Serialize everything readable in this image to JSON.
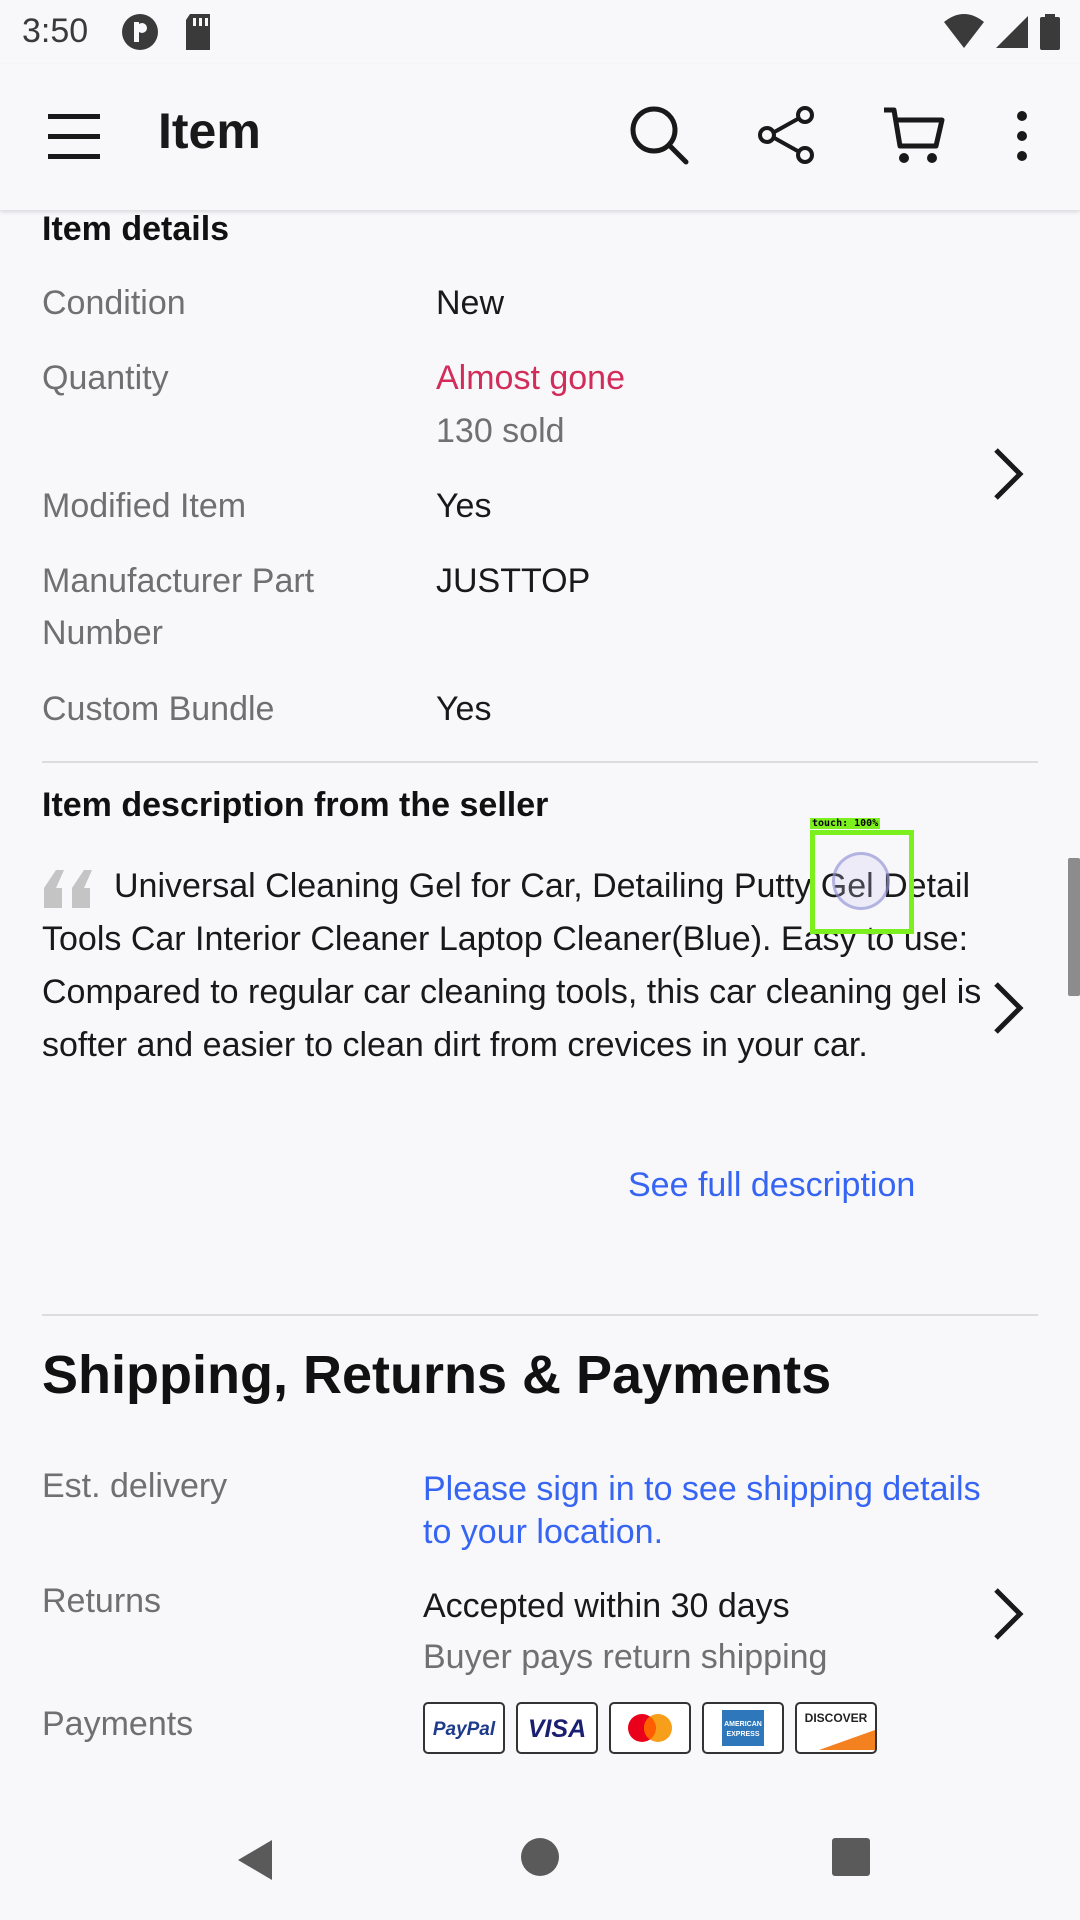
{
  "status_bar": {
    "time": "3:50",
    "icons": [
      "circle-p-icon",
      "sd-card-icon",
      "wifi-icon",
      "signal-icon",
      "battery-icon"
    ]
  },
  "app_bar": {
    "title": "Item",
    "icons": [
      "menu-icon",
      "search-icon",
      "share-icon",
      "cart-icon",
      "more-vert-icon"
    ]
  },
  "item_details": {
    "heading": "Item details",
    "condition_label": "Condition",
    "condition_value": "New",
    "quantity_label": "Quantity",
    "quantity_status": "Almost gone",
    "quantity_sold": "130 sold",
    "modified_label": "Modified Item",
    "modified_value": "Yes",
    "mpn_label": "Manufacturer Part Number",
    "mpn_value": "JUSTTOP",
    "bundle_label": "Custom Bundle",
    "bundle_value": "Yes"
  },
  "description": {
    "heading": "Item description from the seller",
    "text": "Universal Cleaning Gel for Car, Detailing Putty Gel Detail Tools Car Interior Cleaner Laptop Cleaner(Blue). Easy to use: Compared to regular car cleaning tools, this car cleaning gel is softer and easier to clean dirt from crevices in your car.",
    "see_full": "See full description"
  },
  "shipping": {
    "heading": "Shipping, Returns & Payments",
    "delivery_label": "Est. delivery",
    "delivery_value": "Please sign in to see shipping details to your location.",
    "returns_label": "Returns",
    "returns_value": "Accepted within 30 days",
    "returns_sub": "Buyer pays return shipping",
    "payments_label": "Payments",
    "payment_methods": [
      "PayPal",
      "VISA",
      "Mastercard",
      "AMERICAN EXPRESS",
      "DISCOVER"
    ]
  },
  "overlay": {
    "touch_label": "touch: 100%"
  },
  "colors": {
    "accent_link": "#3665f3",
    "urgent_red": "#d22d5a",
    "background": "#f8f7fa"
  }
}
